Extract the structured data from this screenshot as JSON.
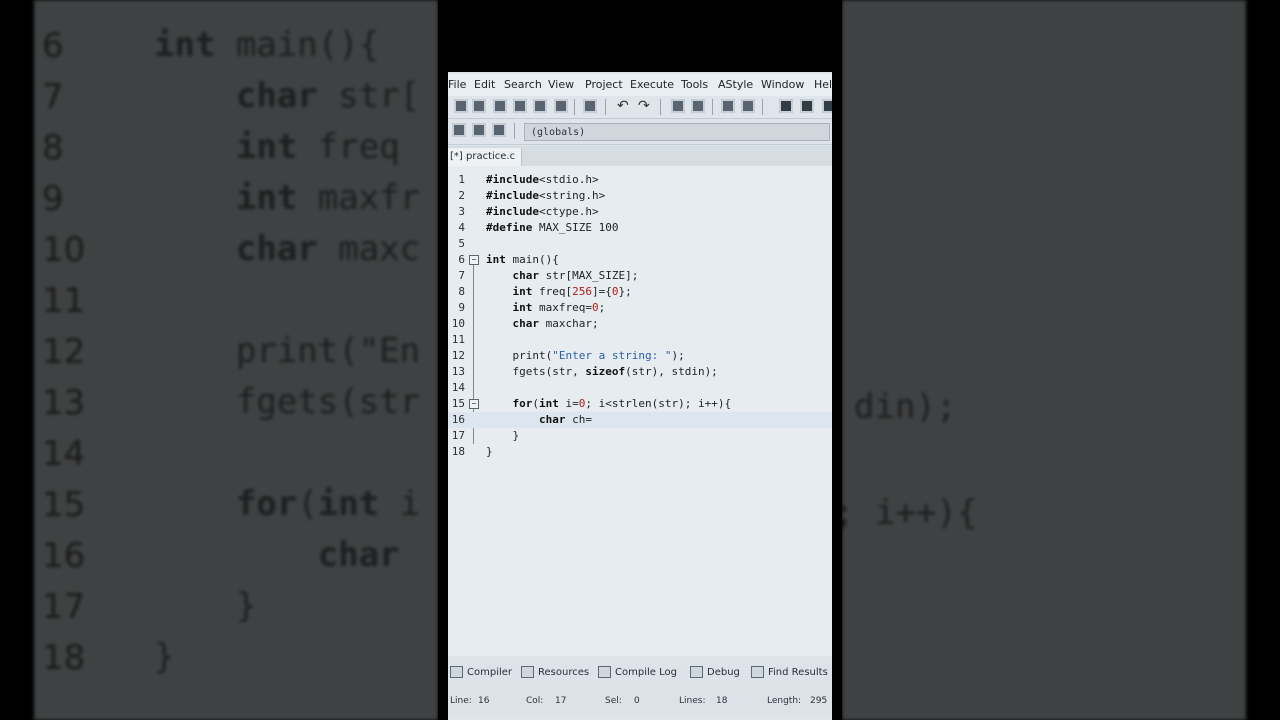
{
  "menu": [
    "File",
    "Edit",
    "Search",
    "View",
    "Project",
    "Execute",
    "Tools",
    "AStyle",
    "Window",
    "Help"
  ],
  "toolbar": {
    "scope_combo": "(globals)"
  },
  "tab": {
    "label": "[*] practice.c"
  },
  "code": [
    {
      "n": "1",
      "text": "#include<stdio.h>"
    },
    {
      "n": "2",
      "text": "#include<string.h>"
    },
    {
      "n": "3",
      "text": "#include<ctype.h>"
    },
    {
      "n": "4",
      "text": "#define MAX_SIZE 100"
    },
    {
      "n": "5",
      "text": ""
    },
    {
      "n": "6",
      "text": "int main(){"
    },
    {
      "n": "7",
      "text": "    char str[MAX_SIZE];"
    },
    {
      "n": "8",
      "text": "    int freq[256]={0};"
    },
    {
      "n": "9",
      "text": "    int maxfreq=0;"
    },
    {
      "n": "10",
      "text": "    char maxchar;"
    },
    {
      "n": "11",
      "text": ""
    },
    {
      "n": "12",
      "text": "    print(\"Enter a string: \");"
    },
    {
      "n": "13",
      "text": "    fgets(str, sizeof(str), stdin);"
    },
    {
      "n": "14",
      "text": ""
    },
    {
      "n": "15",
      "text": "    for(int i=0; i<strlen(str); i++){"
    },
    {
      "n": "16",
      "text": "        char ch="
    },
    {
      "n": "17",
      "text": "    }"
    },
    {
      "n": "18",
      "text": "}"
    }
  ],
  "bottom_tabs": [
    "Compiler",
    "Resources",
    "Compile Log",
    "Debug",
    "Find Results"
  ],
  "status": {
    "line_label": "Line:",
    "line_value": "16",
    "col_label": "Col:",
    "col_value": "17",
    "sel_label": "Sel:",
    "sel_value": "0",
    "lines_label": "Lines:",
    "lines_value": "18",
    "length_label": "Length:",
    "length_value": "295"
  },
  "backdrop_left": [
    {
      "n": "6",
      "text": "int main(){"
    },
    {
      "n": "7",
      "text": "    char str["
    },
    {
      "n": "8",
      "text": "    int freq"
    },
    {
      "n": "9",
      "text": "    int maxfr"
    },
    {
      "n": "10",
      "text": "    char maxc"
    },
    {
      "n": "11",
      "text": ""
    },
    {
      "n": "12",
      "text": "    print(\"En"
    },
    {
      "n": "13",
      "text": "    fgets(str"
    },
    {
      "n": "14",
      "text": ""
    },
    {
      "n": "15",
      "text": "    for(int i"
    },
    {
      "n": "16",
      "text": "        char"
    },
    {
      "n": "17",
      "text": "    }"
    },
    {
      "n": "18",
      "text": "}"
    }
  ],
  "backdrop_right": [
    {
      "row": "13",
      "text": "din);"
    },
    {
      "row": "15",
      "text": "; i++){"
    }
  ]
}
